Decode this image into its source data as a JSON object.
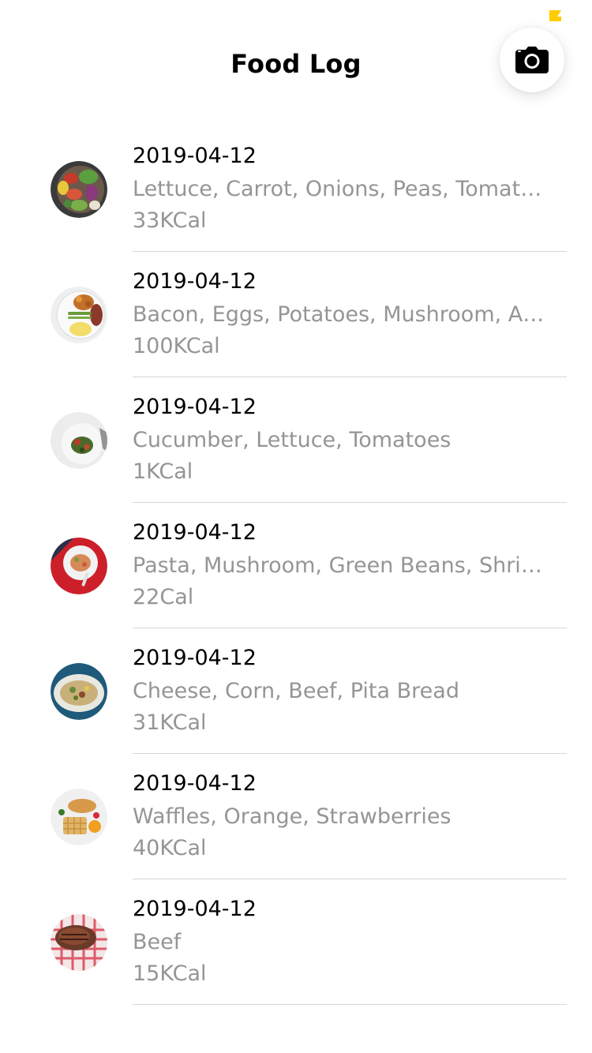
{
  "header": {
    "title": "Food Log",
    "camera_icon": "camera-icon",
    "status_indicator_color": "#FFCC00"
  },
  "entries": [
    {
      "date": "2019-04-12",
      "items": "Lettuce, Carrot, Onions, Peas, Tomatoes",
      "calories": "33KCal",
      "thumbnail": "salad-bowl"
    },
    {
      "date": "2019-04-12",
      "items": "Bacon, Eggs, Potatoes, Mushroom, Asparagus",
      "calories": "100KCal",
      "thumbnail": "breakfast-plate"
    },
    {
      "date": "2019-04-12",
      "items": "Cucumber, Lettuce, Tomatoes",
      "calories": "1KCal",
      "thumbnail": "green-salad"
    },
    {
      "date": "2019-04-12",
      "items": "Pasta, Mushroom, Green Beans, Shrimp",
      "calories": "22Cal",
      "thumbnail": "pasta-plate"
    },
    {
      "date": "2019-04-12",
      "items": "Cheese, Corn, Beef, Pita Bread",
      "calories": "31KCal",
      "thumbnail": "pita-plate"
    },
    {
      "date": "2019-04-12",
      "items": "Waffles, Orange, Strawberries",
      "calories": "40KCal",
      "thumbnail": "waffle-plate"
    },
    {
      "date": "2019-04-12",
      "items": "Beef",
      "calories": "15KCal",
      "thumbnail": "beef-roast"
    }
  ],
  "colors": {
    "text_primary": "#000000",
    "text_secondary": "#959595",
    "divider": "#D6D6D6",
    "background": "#FFFFFF"
  }
}
